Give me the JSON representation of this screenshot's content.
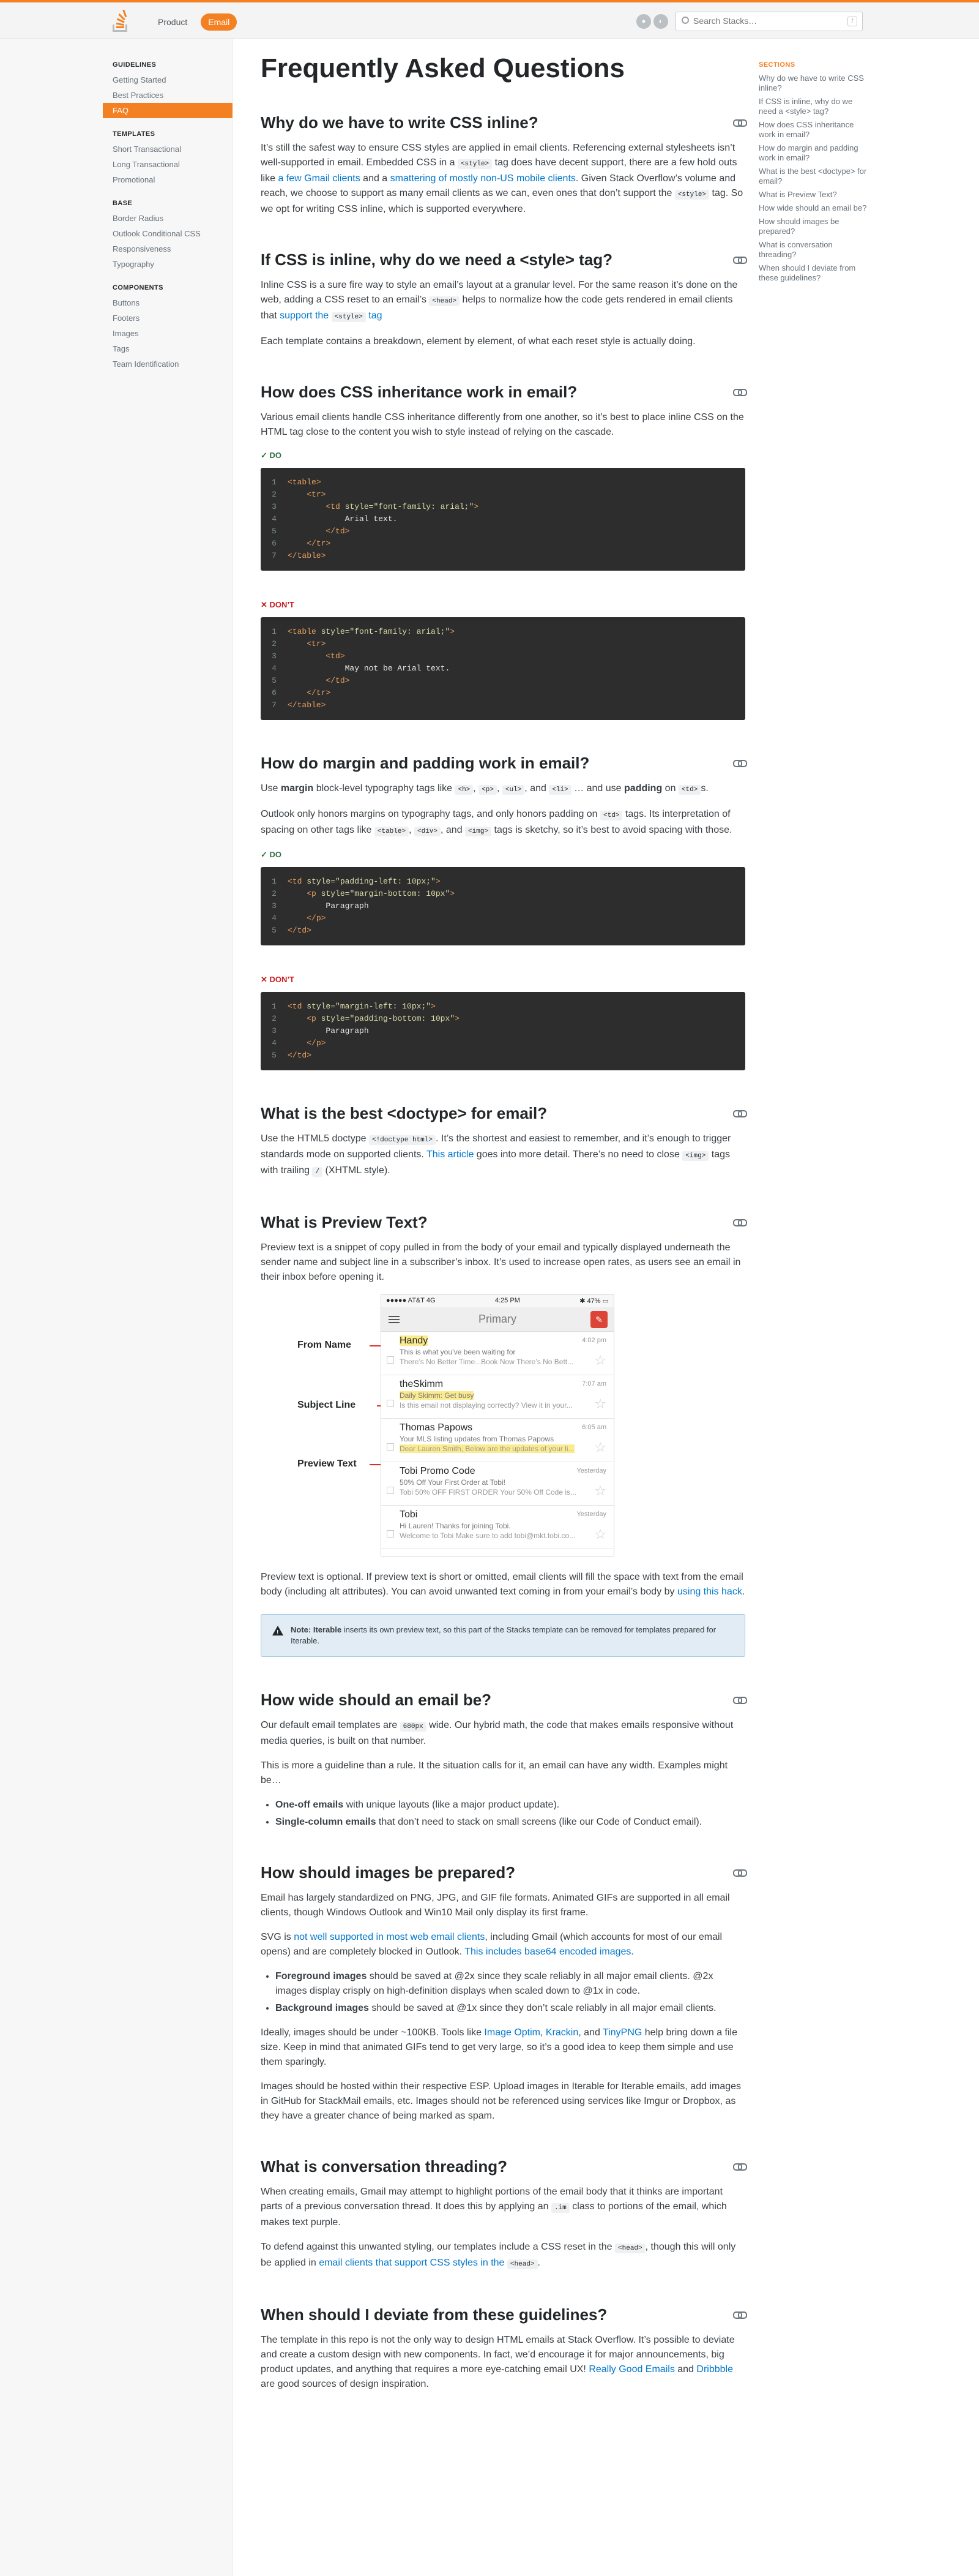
{
  "header": {
    "nav": [
      "Product",
      "Email"
    ],
    "search_placeholder": "Search Stacks…",
    "search_shortcut": "/",
    "icons": [
      "github-icon",
      "theme-icon"
    ]
  },
  "leftnav": {
    "groups": [
      {
        "heading": "GUIDELINES",
        "items": [
          "Getting Started",
          "Best Practices",
          "FAQ"
        ]
      },
      {
        "heading": "TEMPLATES",
        "items": [
          "Short Transactional",
          "Long Transactional",
          "Promotional"
        ]
      },
      {
        "heading": "BASE",
        "items": [
          "Border Radius",
          "Outlook Conditional CSS",
          "Responsiveness",
          "Typography"
        ]
      },
      {
        "heading": "COMPONENTS",
        "items": [
          "Buttons",
          "Footers",
          "Images",
          "Tags",
          "Team Identification"
        ]
      }
    ],
    "active": "FAQ"
  },
  "rightnav": {
    "heading": "SECTIONS",
    "items": [
      "Why do we have to write CSS inline?",
      "If CSS is inline, why do we need a <style> tag?",
      "How does CSS inheritance work in email?",
      "How do margin and padding work in email?",
      "What is the best <doctype> for email?",
      "What is Preview Text?",
      "How wide should an email be?",
      "How should images be prepared?",
      "What is conversation threading?",
      "When should I deviate from these guidelines?"
    ]
  },
  "page": {
    "title": "Frequently Asked Questions",
    "s1": {
      "title": "Why do we have to write CSS inline?",
      "p1a": "It’s still the safest way to ensure CSS styles are applied in email clients. Referencing external stylesheets isn’t well-supported in email. Embedded CSS in a ",
      "p1c": "<style>",
      "p1b": " tag does have decent support, there are a few hold outs like ",
      "link1": "a few Gmail clients",
      "p1d": " and a ",
      "link2": "smattering of mostly non-US mobile clients",
      "p1e": ". Given Stack Overflow’s volume and reach, we choose to support as many email clients as we can, even ones that don’t support the ",
      "p1f": " tag. So we opt for writing CSS inline, which is supported everywhere."
    },
    "s2": {
      "title": "If CSS is inline, why do we need a <style> tag?",
      "p1a": "Inline CSS is a sure fire way to style an email’s layout at a granular level. For the same reason it’s done on the web, adding a CSS reset to an email’s ",
      "p1c": "<head>",
      "p1b": " helps to normalize how the code gets rendered in email clients that ",
      "link1": "support the ",
      "link1b": " tag",
      "p2": "Each template contains a breakdown, element by element, of what each reset style is actually doing."
    },
    "s3": {
      "title": "How does CSS inheritance work in email?",
      "p1": "Various email clients handle CSS inheritance differently from one another, so it’s best to place inline CSS on the HTML tag close to the content you wish to style instead of relying on the cascade.",
      "do_label": "DO",
      "dont_label": "DON’T",
      "do_code": [
        "<table>",
        "    <tr>",
        "        <td style=\"font-family: arial;\">",
        "            Arial text.",
        "        </td>",
        "    </tr>",
        "</table>"
      ],
      "dont_code": [
        "<table style=\"font-family: arial;\">",
        "    <tr>",
        "        <td>",
        "            May not be Arial text.",
        "        </td>",
        "    </tr>",
        "</table>"
      ]
    },
    "s4": {
      "title": "How do margin and padding work in email?",
      "p1a": "Use ",
      "margin": "margin",
      "p1b": " block-level typography tags like ",
      "c1": "<h>",
      "c2": "<p>",
      "c3": "<ul>",
      "c4": "<li>",
      "p1c": " … and use ",
      "padding": "padding",
      "p1d": " on ",
      "c5": "<td>",
      "p1e": "s.",
      "p2a": "Outlook only honors margins on typography tags, and only honors padding on ",
      "p2b": " tags. Its interpretation of spacing on other tags like ",
      "c6": "<table>",
      "c7": "<div>",
      "c8": "<img>",
      "p2c": " tags is sketchy, so it’s best to avoid spacing with those.",
      "do_label": "DO",
      "dont_label": "DON’T",
      "do_code": [
        "<td style=\"padding-left: 10px;\">",
        "    <p style=\"margin-bottom: 10px\">",
        "        Paragraph",
        "    </p>",
        "</td>"
      ],
      "dont_code": [
        "<td style=\"margin-left: 10px;\">",
        "    <p style=\"padding-bottom: 10px\">",
        "        Paragraph",
        "    </p>",
        "</td>"
      ]
    },
    "s5": {
      "title": "What is the best <doctype> for email?",
      "p1a": "Use the HTML5 doctype ",
      "c1": "<!doctype html>",
      "p1b": ". It’s the shortest and easiest to remember, and it’s enough to trigger standards mode on supported clients. ",
      "link1": "This article",
      "p1c": " goes into more detail. There’s no need to close ",
      "c2": "<img>",
      "p1d": " tags with trailing ",
      "c3": "/",
      "p1e": " (XHTML style)."
    },
    "s6": {
      "title": "What is Preview Text?",
      "p1": "Preview text is a snippet of copy pulled in from the body of your email and typically displayed underneath the sender name and subject line in a subscriber’s inbox. It’s used to increase open rates, as users see an email in their inbox before opening it.",
      "callouts": [
        "From Name",
        "Subject Line",
        "Preview Text"
      ],
      "phone": {
        "carrier": "●●●●● AT&T  4G",
        "time": "4:25 PM",
        "battery": "✱ 47% ▭",
        "inbox": "Primary",
        "emails": [
          {
            "from": "Handy",
            "time": "4:02 pm",
            "subject": "This is what you’ve been waiting for",
            "preview": "There’s No Better Time...Book Now There’s No Bett..."
          },
          {
            "from": "theSkimm",
            "time": "7:07 am",
            "subject": "Daily Skimm: Get busy",
            "preview": "Is this email not displaying correctly? View it in your..."
          },
          {
            "from": "Thomas Papows",
            "time": "6:05 am",
            "subject": "Your MLS listing updates from Thomas Papows",
            "preview": "Dear Lauren Smith, Below are the updates of your li..."
          },
          {
            "from": "Tobi Promo Code",
            "time": "Yesterday",
            "subject": "50% Off Your First Order at Tobi!",
            "preview": "Tobi 50% OFF FIRST ORDER Your 50% Off Code is..."
          },
          {
            "from": "Tobi",
            "time": "Yesterday",
            "subject": "Hi Lauren! Thanks for joining Tobi.",
            "preview": "Welcome to Tobi Make sure to add tobi@mkt.tobi.co..."
          }
        ]
      },
      "p2a": "Preview text is optional. If preview text is short or omitted, email clients will fill the space with text from the email body (including alt attributes). You can avoid unwanted text coming in from your email’s body by ",
      "link1": "using this hack",
      "p2b": ".",
      "note_a": "Note: Iterable",
      "note_b": " inserts its own preview text, so this part of the Stacks template can be removed for templates prepared for Iterable."
    },
    "s7": {
      "title": "How wide should an email be?",
      "p1a": "Our default email templates are ",
      "c1": "680px",
      "p1b": " wide. Our hybrid math, the code that makes emails responsive without media queries, is built on that number.",
      "p2": "This is more a guideline than a rule. It the situation calls for it, an email can have any width. Examples might be…",
      "b1a": "One-off emails",
      "b1b": " with unique layouts (like a major product update).",
      "b2a": "Single-column emails",
      "b2b": " that don’t need to stack on small screens (like our Code of Conduct email)."
    },
    "s8": {
      "title": "How should images be prepared?",
      "p1": "Email has largely standardized on PNG, JPG, and GIF file formats. Animated GIFs are supported in all email clients, though Windows Outlook and Win10 Mail only display its first frame.",
      "p2a": "SVG is ",
      "link1": "not well supported in most web email clients",
      "p2b": ", including Gmail (which accounts for most of our email opens) and are completely blocked in Outlook. ",
      "link2": "This includes base64 encoded images",
      "p2c": ".",
      "b1a": "Foreground images",
      "b1b": " should be saved at @2x since they scale reliably in all major email clients. @2x images display crisply on high-definition displays when scaled down to @1x in code.",
      "b2a": "Background images",
      "b2b": " should be saved at @1x since they don’t scale reliably in all major email clients.",
      "p3a": "Ideally, images should be under ~100KB. Tools like ",
      "link3": "Image Optim",
      "p3b": ", ",
      "link4": "Krackin",
      "p3c": ", and ",
      "link5": "TinyPNG",
      "p3d": " help bring down a file size. Keep in mind that animated GIFs tend to get very large, so it’s a good idea to keep them simple and use them sparingly.",
      "p4": "Images should be hosted within their respective ESP. Upload images in Iterable for Iterable emails, add images in GitHub for StackMail emails, etc. Images should not be referenced using services like Imgur or Dropbox, as they have a greater chance of being marked as spam."
    },
    "s9": {
      "title": "What is conversation threading?",
      "p1a": "When creating emails, Gmail may attempt to highlight portions of the email body that it thinks are important parts of a previous conversation thread. It does this by applying an ",
      "c1": ".im",
      "p1b": " class to portions of the email, which makes text purple.",
      "p2a": "To defend against this unwanted styling, our templates include a CSS reset in the ",
      "c2": "<head>",
      "p2b": ", though this will only be applied in ",
      "link1": "email clients that support CSS styles in the ",
      "p2c": "."
    },
    "s10": {
      "title": "When should I deviate from these guidelines?",
      "p1a": "The template in this repo is not the only way to design HTML emails at Stack Overflow. It’s possible to deviate and create a custom design with new components. In fact, we’d encourage it for major announcements, big product updates, and anything that requires a more eye-catching email UX! ",
      "link1": "Really Good Emails",
      "p1b": " and ",
      "link2": "Dribbble",
      "p1c": " are good sources of design inspiration."
    }
  },
  "colors": {
    "accent": "#f48024",
    "link": "#0077cc",
    "do": "#2f6f44",
    "dont": "#c91d22",
    "code_bg": "#2d2d2d",
    "note_bg": "#e1ecf4"
  }
}
